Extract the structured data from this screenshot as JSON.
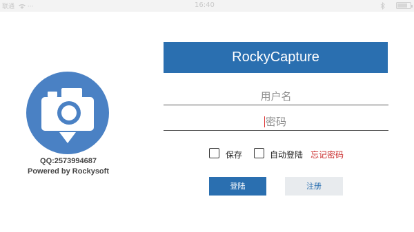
{
  "status_bar": {
    "carrier": "联通",
    "dots": "···",
    "time": "16:40",
    "battery_level": 0.8,
    "icons": [
      "wifi-icon",
      "bluetooth-icon",
      "battery-icon"
    ]
  },
  "brand": {
    "logo_icon": "camera-pin-icon",
    "qq": "QQ:2573994687",
    "powered_by": "Powered by Rockysoft"
  },
  "header": {
    "title": "RockyCapture"
  },
  "form": {
    "username": {
      "value": "",
      "placeholder": "用户名"
    },
    "password": {
      "value": "",
      "placeholder": "密码"
    },
    "save": {
      "label": "保存",
      "checked": false
    },
    "auto_login": {
      "label": "自动登陆",
      "checked": false
    },
    "forgot_label": "忘记密码",
    "login_label": "登陆",
    "register_label": "注册"
  },
  "colors": {
    "primary": "#2a6fb0",
    "logo_circle": "#4a81c4",
    "link_red": "#c92a2a",
    "secondary_button": "#e8ebee"
  }
}
